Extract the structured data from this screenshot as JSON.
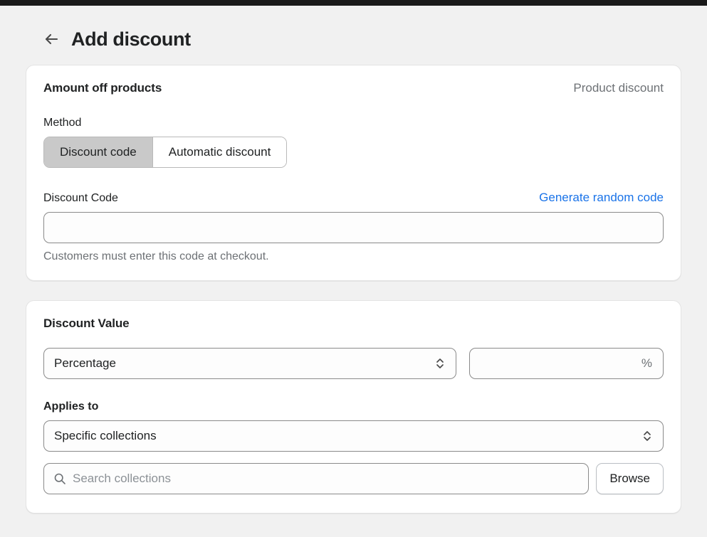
{
  "header": {
    "back_icon": "arrow-left-icon",
    "title": "Add discount"
  },
  "discount_card": {
    "title": "Amount off products",
    "kicker": "Product discount",
    "method_label": "Method",
    "method_options": [
      {
        "label": "Discount code",
        "selected": true
      },
      {
        "label": "Automatic discount",
        "selected": false
      }
    ],
    "code_label": "Discount Code",
    "generate_link": "Generate random code",
    "code_value": "",
    "code_placeholder": "",
    "helper_text": "Customers must enter this code at checkout."
  },
  "value_card": {
    "title": "Discount Value",
    "type_select": {
      "value": "Percentage",
      "icon": "chevron-updown-icon"
    },
    "amount_input": {
      "value": "",
      "placeholder": "",
      "suffix": "%"
    },
    "applies_to_label": "Applies to",
    "applies_to_select": {
      "value": "Specific collections",
      "icon": "chevron-updown-icon"
    },
    "search": {
      "icon": "search-icon",
      "value": "",
      "placeholder": "Search collections"
    },
    "browse_label": "Browse"
  },
  "colors": {
    "background": "#f1f1f1",
    "card": "#ffffff",
    "link": "#1a73e8",
    "selected_segment": "#c9c9c9",
    "subdued_text": "#6d7175",
    "top_bar": "#1a1a1a"
  }
}
